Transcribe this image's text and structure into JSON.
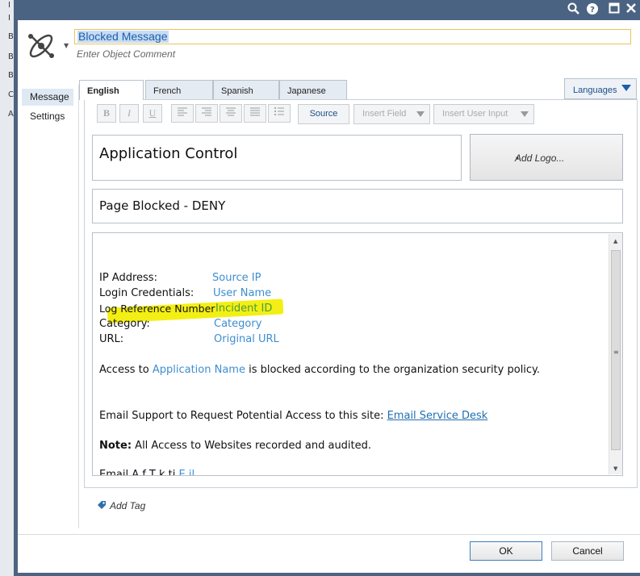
{
  "background_window": {
    "letters": [
      "I",
      "I",
      "B",
      "B",
      "B",
      "C",
      "A"
    ]
  },
  "titlebar": {
    "icons": [
      "search-icon",
      "help-icon",
      "maximize-icon",
      "close-icon"
    ]
  },
  "header": {
    "object_name": "Blocked Message",
    "object_comment": "Enter Object Comment"
  },
  "nav": {
    "items": [
      "Message",
      "Settings"
    ],
    "active": "Message"
  },
  "tabs": [
    "English",
    "French",
    "Spanish",
    "Japanese"
  ],
  "languages_button": "Languages",
  "toolbar": {
    "format_buttons": [
      "B",
      "I",
      "U"
    ],
    "source": "Source",
    "insert_field": "Insert Field",
    "insert_user_input": "Insert User Input"
  },
  "message": {
    "title": "Application Control",
    "add_logo": "Add Logo...",
    "subtitle": "Page Blocked - DENY",
    "rows": [
      {
        "label": "IP Address:",
        "field": "Source IP"
      },
      {
        "label": "Login Credentials:",
        "field": "User Name"
      },
      {
        "label": "Log Reference Number",
        "field": "Incident ID"
      },
      {
        "label": "Category:",
        "field": "Category"
      },
      {
        "label": "URL:",
        "field": "Original URL"
      }
    ],
    "access_pre": "Access to ",
    "access_field": "Application Name",
    "access_post": " is blocked according to the organization security policy.",
    "email_text": "Email Support to Request Potential Access to this site: ",
    "email_link": "Email Service Desk",
    "note_label": "Note:",
    "note_text": " All Access to Websites recorded and audited.",
    "partial_pre": "Email A   f   T k   ti",
    "partial_link": "E   il"
  },
  "add_tag": "Add Tag",
  "buttons": {
    "ok": "OK",
    "cancel": "Cancel"
  },
  "colors": {
    "accent": "#1c5fa8",
    "field_link": "#3e8ed0",
    "highlight": "#f3ef15",
    "frame": "#4b6383"
  }
}
